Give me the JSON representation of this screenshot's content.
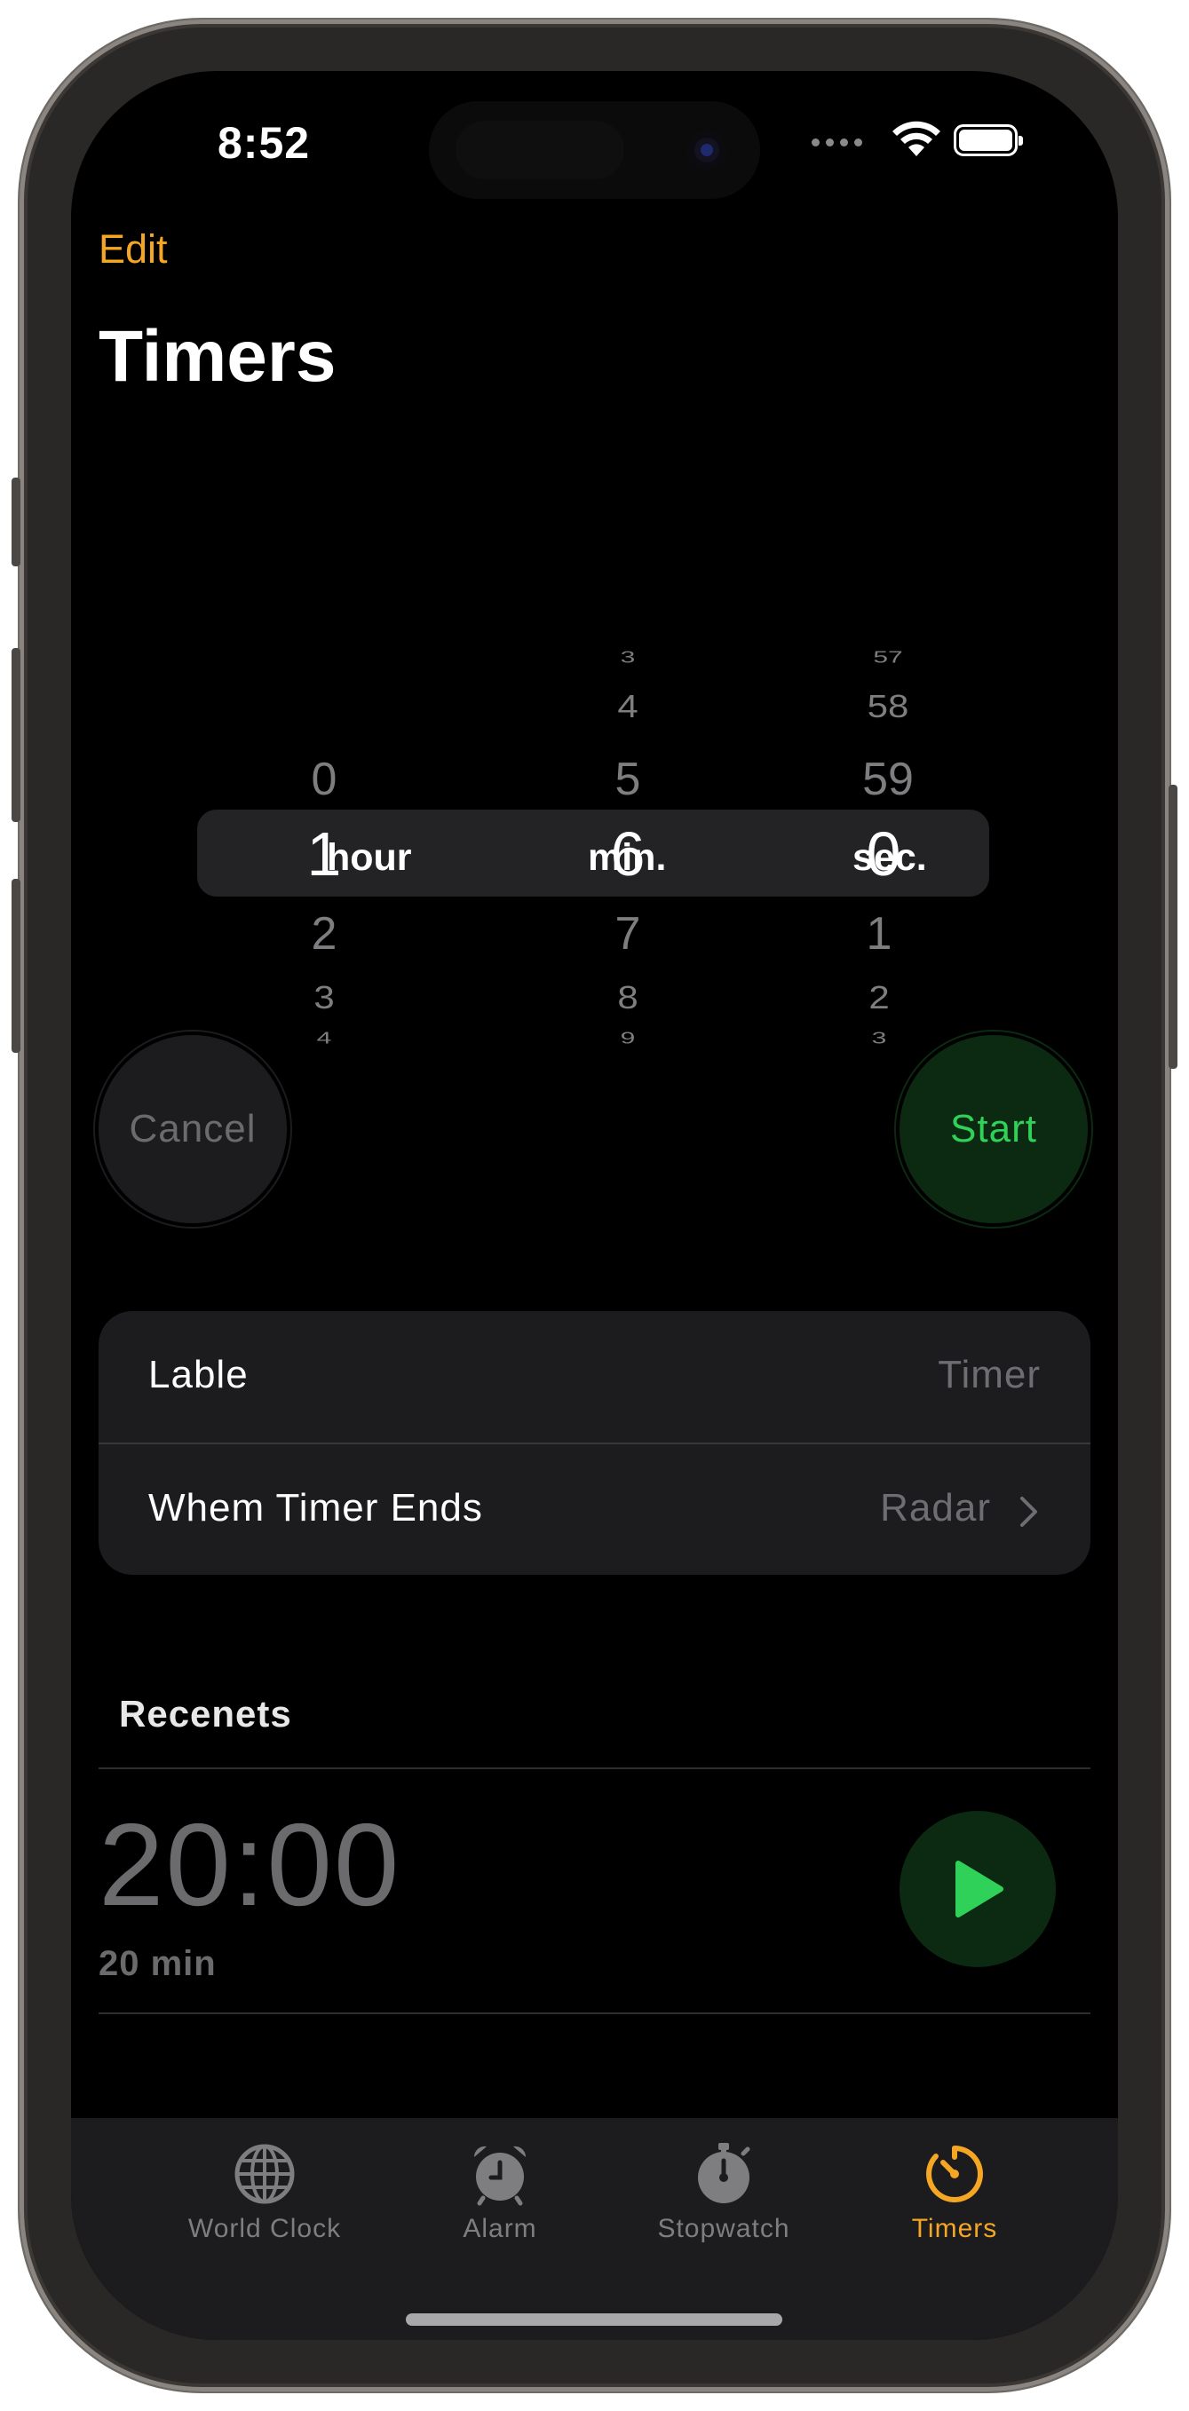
{
  "status_bar": {
    "time": "8:52"
  },
  "nav": {
    "edit_label": "Edit",
    "title": "Timers"
  },
  "picker": {
    "hours": {
      "above": [
        "0"
      ],
      "selected": "1",
      "unit": "hour",
      "below": [
        "2",
        "3",
        "4"
      ]
    },
    "minutes": {
      "above": [
        "3",
        "4",
        "5"
      ],
      "selected": "6",
      "unit": "min.",
      "below": [
        "7",
        "8",
        "9"
      ]
    },
    "seconds": {
      "above": [
        "57",
        "58",
        "59"
      ],
      "selected": "0",
      "unit": "sec.",
      "below": [
        "1",
        "2",
        "3"
      ]
    }
  },
  "buttons": {
    "cancel": "Cancel",
    "start": "Start"
  },
  "options": {
    "label_row": {
      "label": "Lable",
      "value": "Timer"
    },
    "sound_row": {
      "label": "Whem Timer Ends",
      "value": "Radar"
    }
  },
  "recents": {
    "heading": "Recenets",
    "items": [
      {
        "time": "20:00",
        "subtitle": "20 min"
      }
    ]
  },
  "tabbar": {
    "items": [
      {
        "label": "World Clock",
        "icon": "globe-icon"
      },
      {
        "label": "Alarm",
        "icon": "alarm-clock-icon"
      },
      {
        "label": "Stopwatch",
        "icon": "stopwatch-icon"
      },
      {
        "label": "Timers",
        "icon": "timer-icon"
      }
    ],
    "active": "Timers"
  },
  "colors": {
    "accent": "#f5a623",
    "start_green": "#30d158",
    "start_bg": "#0c2a12",
    "cell_bg": "#1c1c1e"
  }
}
